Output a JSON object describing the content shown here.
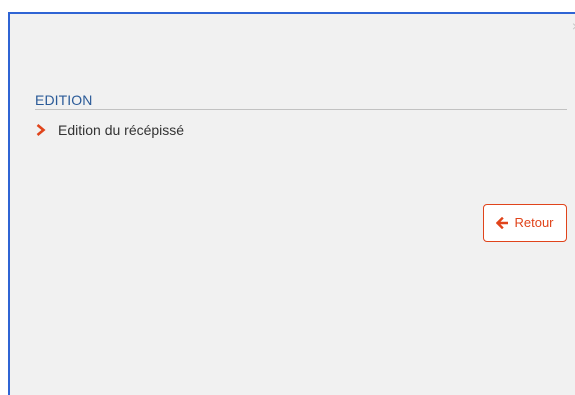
{
  "dialog": {
    "close_glyph": "×",
    "section_title": "EDITION",
    "menu": {
      "item_label": "Edition du récépissé",
      "item_icon": "chevron-right-icon"
    },
    "back_button": {
      "label": "Retour",
      "icon": "arrow-left-icon"
    }
  },
  "colors": {
    "accent": "#e0441b",
    "title": "#2a5a98",
    "frame_border": "#2f64d4",
    "background": "#f1f1f1"
  }
}
